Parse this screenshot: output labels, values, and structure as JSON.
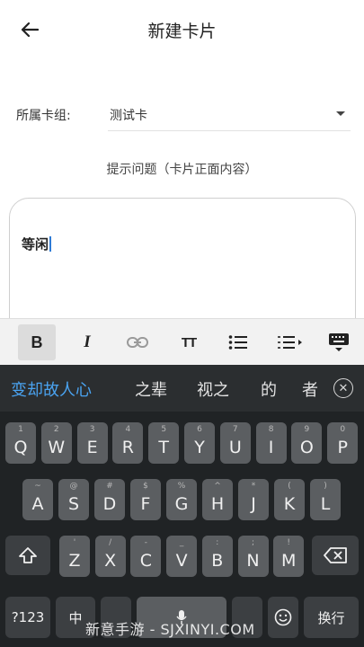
{
  "header": {
    "title": "新建卡片",
    "back_icon": "arrow-left-icon"
  },
  "deck": {
    "label": "所属卡组:",
    "value": "测试卡"
  },
  "prompt": {
    "label": "提示问题（卡片正面内容）"
  },
  "editor": {
    "text": "等闲",
    "caret_color": "#2f7bd6"
  },
  "toolbar": {
    "bold_label": "B",
    "italic_label": "I",
    "text_size_label": "TT",
    "icons": [
      "bold-icon",
      "italic-icon",
      "link-icon",
      "text-size-icon",
      "bullet-list-icon",
      "numbered-list-icon",
      "hide-keyboard-icon"
    ]
  },
  "keyboard": {
    "candidates": [
      "变却故人心",
      "之辈",
      "视之",
      "的",
      "者"
    ],
    "row1": [
      {
        "k": "Q",
        "s": "1"
      },
      {
        "k": "W",
        "s": "2"
      },
      {
        "k": "E",
        "s": "3"
      },
      {
        "k": "R",
        "s": "4"
      },
      {
        "k": "T",
        "s": "5"
      },
      {
        "k": "Y",
        "s": "6"
      },
      {
        "k": "U",
        "s": "7"
      },
      {
        "k": "I",
        "s": "8"
      },
      {
        "k": "O",
        "s": "9"
      },
      {
        "k": "P",
        "s": "0"
      }
    ],
    "row2": [
      {
        "k": "A",
        "s": "~"
      },
      {
        "k": "S",
        "s": "@"
      },
      {
        "k": "D",
        "s": "#"
      },
      {
        "k": "F",
        "s": "$"
      },
      {
        "k": "G",
        "s": "%"
      },
      {
        "k": "H",
        "s": "^"
      },
      {
        "k": "J",
        "s": "*"
      },
      {
        "k": "K",
        "s": "("
      },
      {
        "k": "L",
        "s": ")"
      }
    ],
    "row3": [
      {
        "k": "Z",
        "s": "'"
      },
      {
        "k": "X",
        "s": "/"
      },
      {
        "k": "C",
        "s": "-"
      },
      {
        "k": "V",
        "s": "_"
      },
      {
        "k": "B",
        "s": ":"
      },
      {
        "k": "N",
        "s": ";"
      },
      {
        "k": "M",
        "s": "!"
      }
    ],
    "mode_label": "?123",
    "lang_label": "中",
    "enter_label": "换行",
    "accent_color": "#4aa3f0"
  },
  "watermark": "新意手游 - SJXINYI.COM"
}
